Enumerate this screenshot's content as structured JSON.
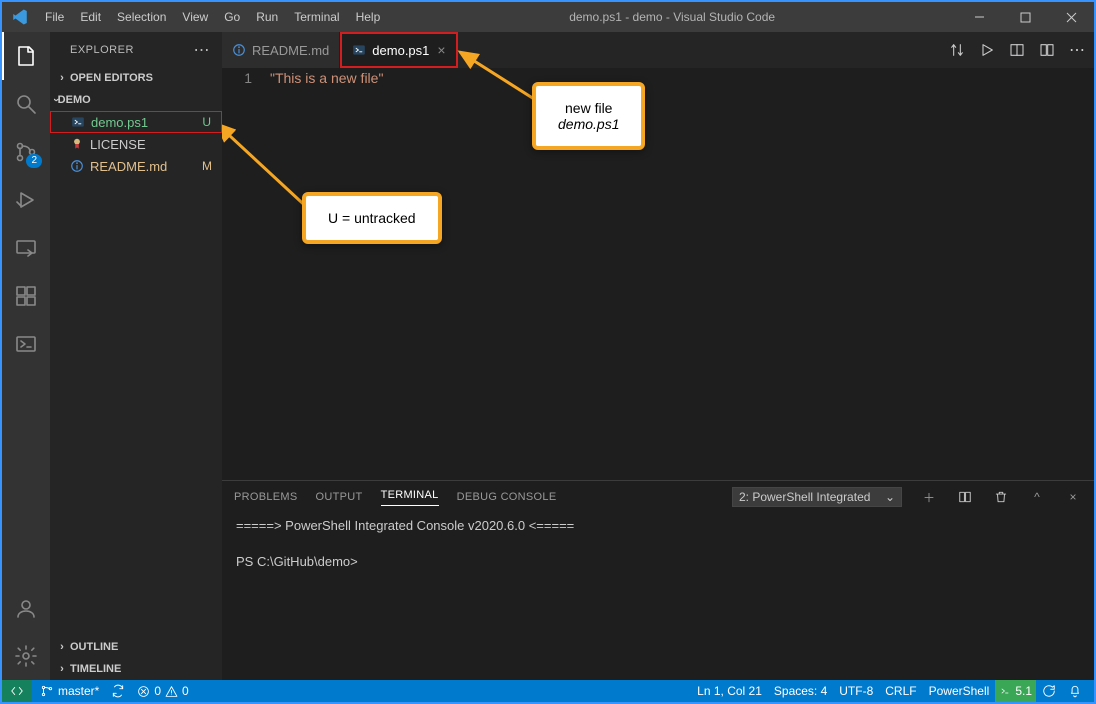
{
  "window": {
    "title": "demo.ps1 - demo - Visual Studio Code"
  },
  "menubar": [
    "File",
    "Edit",
    "Selection",
    "View",
    "Go",
    "Run",
    "Terminal",
    "Help"
  ],
  "activitybar": {
    "scm_badge": "2"
  },
  "explorer": {
    "title": "EXPLORER",
    "open_editors": "OPEN EDITORS",
    "project": "DEMO",
    "files": [
      {
        "name": "demo.ps1",
        "status": "U"
      },
      {
        "name": "LICENSE",
        "status": ""
      },
      {
        "name": "README.md",
        "status": "M"
      }
    ],
    "outline": "OUTLINE",
    "timeline": "TIMELINE"
  },
  "tabs": [
    {
      "name": "README.md",
      "active": false
    },
    {
      "name": "demo.ps1",
      "active": true
    }
  ],
  "editor": {
    "line_number": "1",
    "code": "\"This is a new file\""
  },
  "panel": {
    "tabs": [
      "PROBLEMS",
      "OUTPUT",
      "TERMINAL",
      "DEBUG CONSOLE"
    ],
    "active": "TERMINAL",
    "picker": "2: PowerShell Integrated",
    "line1": "=====> PowerShell Integrated Console v2020.6.0 <=====",
    "prompt": "PS C:\\GitHub\\demo>"
  },
  "status": {
    "branch": "master*",
    "sync": "",
    "errors": "0",
    "warnings": "0",
    "lncol": "Ln 1, Col 21",
    "spaces": "Spaces: 4",
    "encoding": "UTF-8",
    "eol": "CRLF",
    "lang": "PowerShell",
    "ps_ver": "5.1"
  },
  "callouts": {
    "untracked": "U = untracked",
    "newfile_l1": "new file",
    "newfile_l2": "demo.ps1"
  }
}
